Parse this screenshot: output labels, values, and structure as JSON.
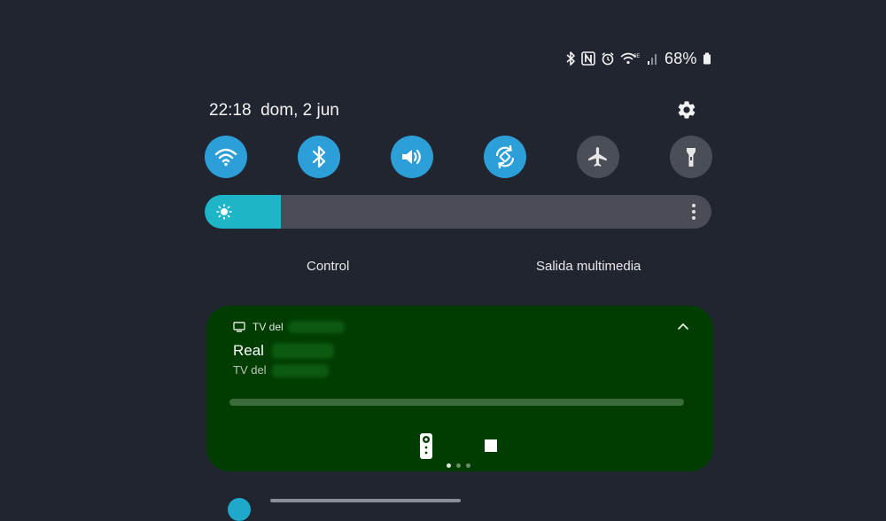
{
  "status_bar": {
    "icons": [
      "bluetooth-icon",
      "nfc-icon",
      "alarm-icon",
      "wifi-6e-icon",
      "signal-icon",
      "battery-icon"
    ],
    "battery_percent": "68%"
  },
  "header": {
    "clock": "22:18",
    "date": "dom, 2 jun",
    "settings_icon": "gear-icon"
  },
  "quick_toggles": [
    {
      "name": "wifi",
      "icon": "wifi-icon",
      "state": "on"
    },
    {
      "name": "bluetooth",
      "icon": "bluetooth-icon",
      "state": "on"
    },
    {
      "name": "sound",
      "icon": "volume-icon",
      "state": "on"
    },
    {
      "name": "auto-rotate",
      "icon": "rotate-icon",
      "state": "on"
    },
    {
      "name": "airplane-mode",
      "icon": "airplane-icon",
      "state": "off"
    },
    {
      "name": "flashlight",
      "icon": "flashlight-icon",
      "state": "off"
    }
  ],
  "brightness": {
    "level_percent": 15,
    "icon": "sun-icon",
    "more_icon": "more-vertical-icon"
  },
  "device_controls": {
    "control_label": "Control",
    "media_output_label": "Salida multimedia"
  },
  "media_card": {
    "device_label": "TV del",
    "title": "Real",
    "subtitle": "TV del",
    "progress_percent": 0,
    "remote_icon": "remote-control-icon",
    "stop_icon": "stop-icon",
    "collapse_icon": "chevron-up-icon",
    "page_count": 3,
    "active_page": 1
  },
  "colors": {
    "background": "#212530",
    "toggle_on": "#2d9fd8",
    "toggle_off": "#4a4e57",
    "brightness_fill": "#1eb5c9",
    "media_card_bg": "#013d01"
  }
}
